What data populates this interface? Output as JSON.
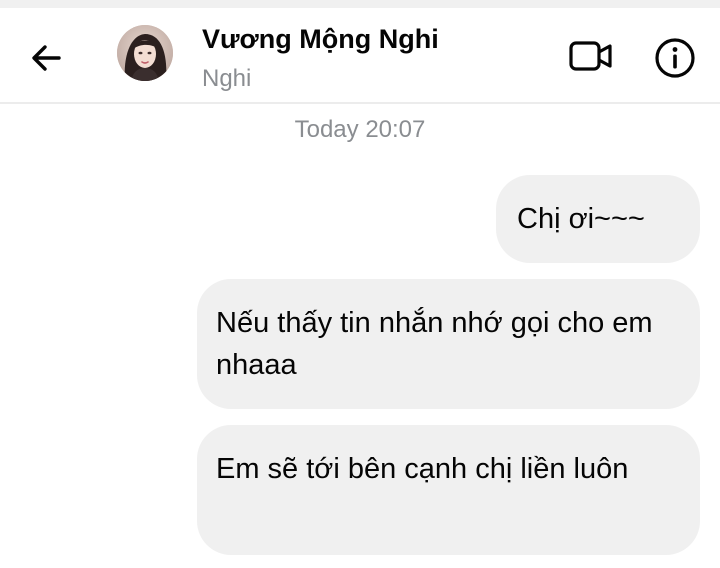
{
  "header": {
    "contact_name": "Vương Mộng Nghi",
    "contact_nickname": "Nghi",
    "back_icon": "arrow-left-icon",
    "video_icon": "video-camera-icon",
    "info_icon": "info-icon"
  },
  "conversation": {
    "timestamp": "Today 20:07",
    "messages": [
      {
        "text": "Chị ơi~~~",
        "direction": "received"
      },
      {
        "text": "Nếu thấy tin nhắn nhớ gọi cho em nhaaa",
        "direction": "received"
      },
      {
        "text": "Em sẽ tới bên cạnh chị liền luôn",
        "direction": "received"
      }
    ]
  },
  "colors": {
    "bubble_background": "#f0f0f0",
    "muted_text": "#8a8d91",
    "primary_text": "#050505"
  }
}
